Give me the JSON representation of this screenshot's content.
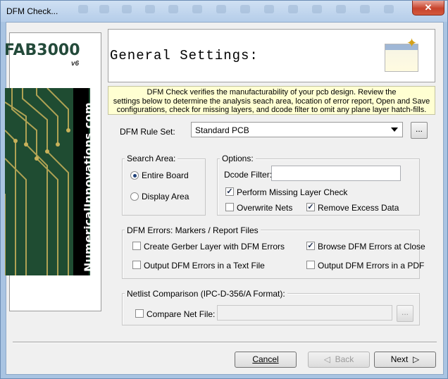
{
  "window": {
    "title": "DFM Check..."
  },
  "sidebar": {
    "logo": "FAB3000",
    "version": "v6",
    "vertical_text": "NumericalInnovations.com"
  },
  "header": {
    "title": "General Settings:"
  },
  "info": {
    "line1": "DFM Check verifies the manufacturability of your pcb design.  Review the",
    "line2": "settings below to determine the analysis seach area, location of error report, Open and Save",
    "line3": "configurations, check for missing layers, and dcode filter to omit any plane layer hatch-fills."
  },
  "rule_set": {
    "label": "DFM Rule Set:",
    "value": "Standard PCB",
    "browse_label": "..."
  },
  "search_area": {
    "title": "Search Area:",
    "entire_board": "Entire Board",
    "display_area": "Display Area",
    "selected": "Entire Board"
  },
  "options": {
    "title": "Options:",
    "dcode_label": "Dcode Filter:",
    "dcode_value": "",
    "missing_layer": "Perform Missing Layer Check",
    "missing_layer_checked": true,
    "overwrite_nets": "Overwrite Nets",
    "overwrite_nets_checked": false,
    "remove_excess": "Remove Excess Data",
    "remove_excess_checked": true
  },
  "dfm_errors": {
    "title": "DFM Errors: Markers / Report Files",
    "create_gerber": "Create Gerber Layer with DFM Errors",
    "create_gerber_checked": false,
    "browse_close": "Browse DFM Errors at Close",
    "browse_close_checked": true,
    "output_text": "Output DFM Errors in a Text File",
    "output_text_checked": false,
    "output_pdf": "Output DFM Errors in a PDF",
    "output_pdf_checked": false
  },
  "netlist": {
    "title": "Netlist Comparison (IPC-D-356/A Format):",
    "compare_label": "Compare Net File:",
    "compare_checked": false,
    "file_value": "",
    "browse_label": "..."
  },
  "buttons": {
    "cancel": "Cancel",
    "back": "Back",
    "next": "Next"
  },
  "colors": {
    "titlebar": "#b5cde9",
    "info_bg": "#ffffd2",
    "pcb_green": "#1f4c32",
    "close_red": "#c7432c"
  }
}
